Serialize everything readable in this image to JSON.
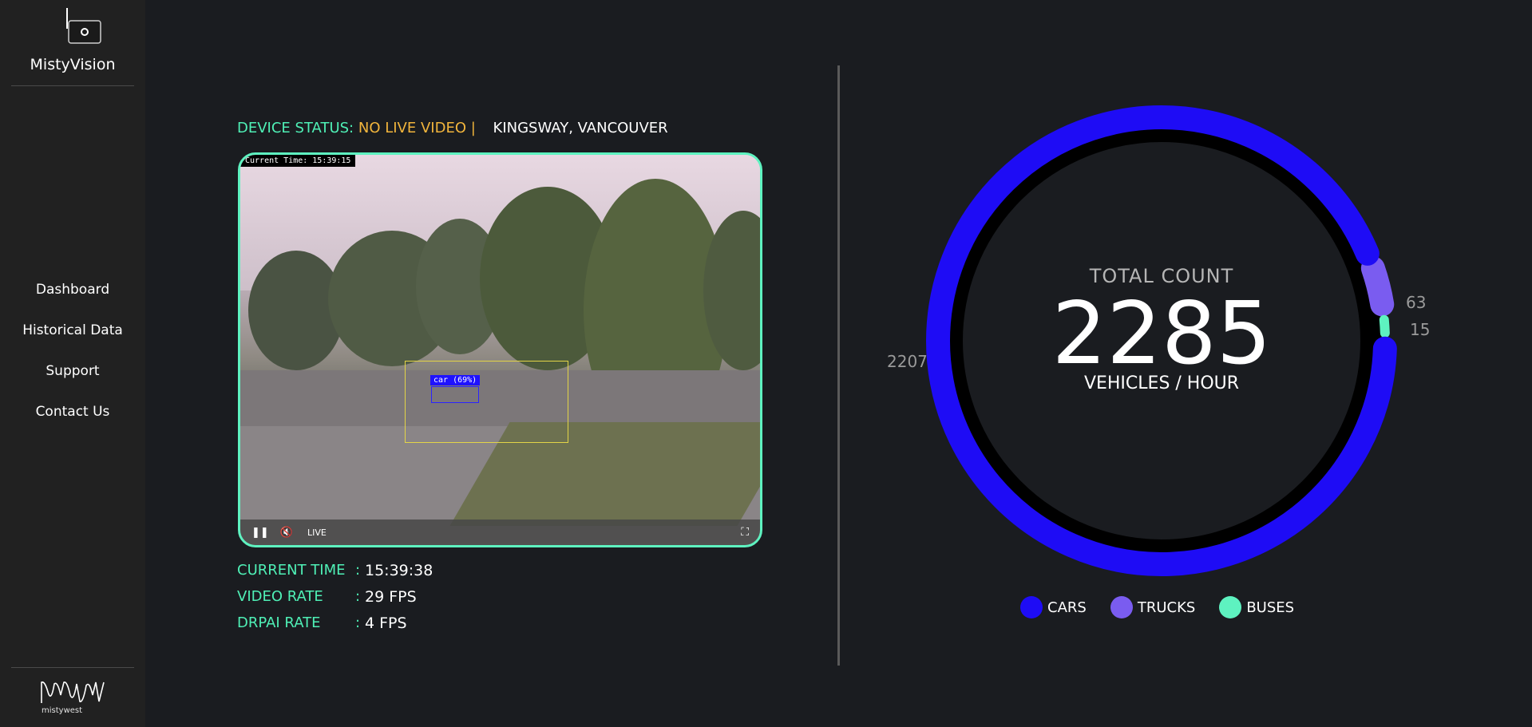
{
  "app": {
    "name": "MistyVision"
  },
  "sidebar": {
    "items": [
      {
        "label": "Dashboard"
      },
      {
        "label": "Historical Data"
      },
      {
        "label": "Support"
      },
      {
        "label": "Contact Us"
      }
    ],
    "footer_brand": "mistywest"
  },
  "status": {
    "label": "DEVICE STATUS:",
    "value": "NO LIVE VIDEO |",
    "location": "KINGSWAY, VANCOUVER"
  },
  "video": {
    "overlay_time": "Current Time: 15:39:15",
    "detection_label": "car (69%)",
    "live_label": "LIVE"
  },
  "metrics": [
    {
      "label": "CURRENT TIME",
      "colon": ":",
      "value": "15:39:38"
    },
    {
      "label": "VIDEO RATE",
      "colon": ":",
      "value": "29 FPS"
    },
    {
      "label": "DRPAI RATE",
      "colon": ":",
      "value": "4 FPS"
    }
  ],
  "gauge": {
    "title": "TOTAL COUNT",
    "total": "2285",
    "unit": "VEHICLES / HOUR",
    "segments": [
      {
        "name": "CARS",
        "value": 2207,
        "display": "2207",
        "color": "#1e0cf5"
      },
      {
        "name": "TRUCKS",
        "value": 63,
        "display": "63",
        "color": "#7a5cf0"
      },
      {
        "name": "BUSES",
        "value": 15,
        "display": "15",
        "color": "#5ef2c0"
      }
    ]
  },
  "legend": [
    {
      "label": "CARS",
      "color": "#1e0cf5"
    },
    {
      "label": "TRUCKS",
      "color": "#7a5cf0"
    },
    {
      "label": "BUSES",
      "color": "#5ef2c0"
    }
  ]
}
